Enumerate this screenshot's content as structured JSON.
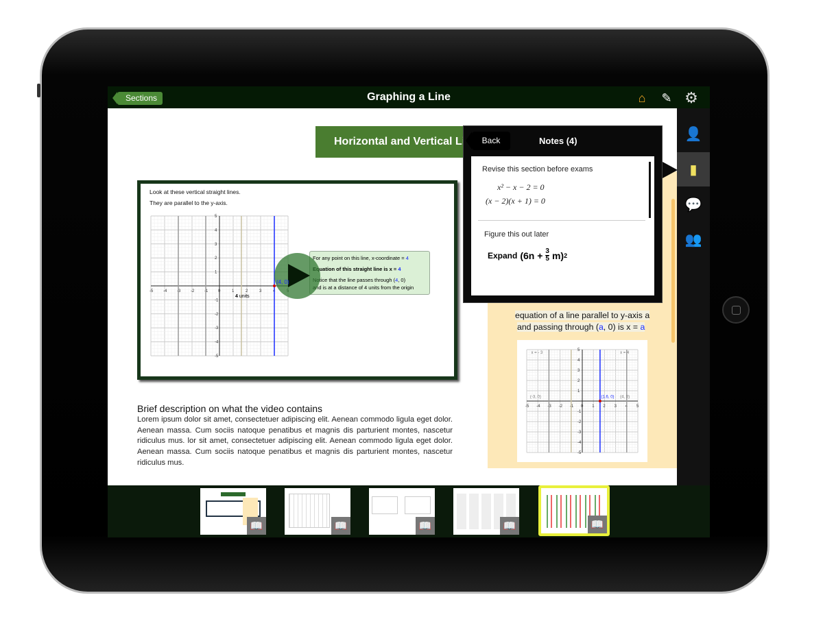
{
  "header": {
    "back_label": "Sections",
    "title": "Graphing a Line",
    "icons": [
      "home-icon",
      "note-edit-icon",
      "gear-icon"
    ]
  },
  "sidebar": {
    "items": [
      {
        "icon": "teacher-icon"
      },
      {
        "icon": "notes-icon",
        "selected": true
      },
      {
        "icon": "chat-icon"
      },
      {
        "icon": "user-discussion-icon"
      }
    ]
  },
  "main": {
    "banner": "Horizontal and Vertical Lines",
    "video": {
      "line1": "Look at these vertical straight lines.",
      "line2": "They are parallel to the y-axis.",
      "callout": {
        "l1": "For any point on this line, x-coordinate = ",
        "l1v": "4",
        "l2": "Equation of this straight line is x = ",
        "l2v": "4",
        "l3a": "Notice that the line passes through (",
        "l3v": "4",
        "l3b": ", 0)",
        "l4": "and is at a distance of 4 units from the origin"
      },
      "point_label": "(4, 0)",
      "brace_num": "4",
      "brace_unit": " units",
      "graph": {
        "xlim": [
          -5,
          5
        ],
        "ylim": [
          -5,
          5
        ],
        "gray_lines": [
          -3,
          -1
        ],
        "tan_lines": [
          1.6
        ],
        "blue_line": 4,
        "axis_x": "x",
        "axis_y": "y"
      }
    },
    "description_title": "Brief description on what the video contains",
    "description": "Lorem ipsum dolor sit amet, consectetuer adipiscing elit. Aenean commodo ligula eget dolor. Aenean massa. Cum sociis natoque penatibus et magnis dis parturient montes, nascetur ridiculus mus. lor sit amet, consectetuer adipiscing elit. Aenean commodo ligula eget dolor. Aenean massa. Cum sociis natoque penatibus et magnis dis parturient montes, nascetur ridiculus mus.",
    "side_panel": {
      "line1": "equation of a line parallel to y-axis a",
      "line2a": "and passing through (",
      "line2v": "a",
      "line2b": ", 0) is x = ",
      "line2v2": "a",
      "graph": {
        "xlim": [
          -5,
          5
        ],
        "ylim": [
          -5,
          5
        ],
        "gray_lines": [
          -3,
          4
        ],
        "tan_lines": [
          -1
        ],
        "blue_line": 1.6,
        "labels": [
          "x = - 3",
          "x = 4",
          "(-3, 0)",
          "(1.6, 0)",
          "(4, 0)"
        ]
      }
    }
  },
  "notes": {
    "back_label": "Back",
    "title": "Notes (4)",
    "items": [
      {
        "text": "Revise this section before exams",
        "math1": "x² − x − 2 = 0",
        "math2": "(x − 2)(x + 1) = 0"
      },
      {
        "text": "Figure this out later",
        "expand": "Expand",
        "expr_a": "(6n + ",
        "frac_num": "3",
        "frac_den": "5",
        "expr_b": "m)",
        "exp": "2"
      }
    ]
  },
  "thumbnails": [
    {
      "icon": "book-icon"
    },
    {
      "icon": "book-icon"
    },
    {
      "icon": "book-icon",
      "highlight": "#eeee33"
    },
    {
      "icon": "book-icon"
    },
    {
      "icon": "book-icon",
      "selected": true
    }
  ],
  "colors": {
    "topbar": "#051a05",
    "accent_green": "#4a7d30",
    "panel_yellow": "#fde8b8",
    "selected_thumb": "#e8f03c",
    "line_blue": "#1a2cff"
  }
}
